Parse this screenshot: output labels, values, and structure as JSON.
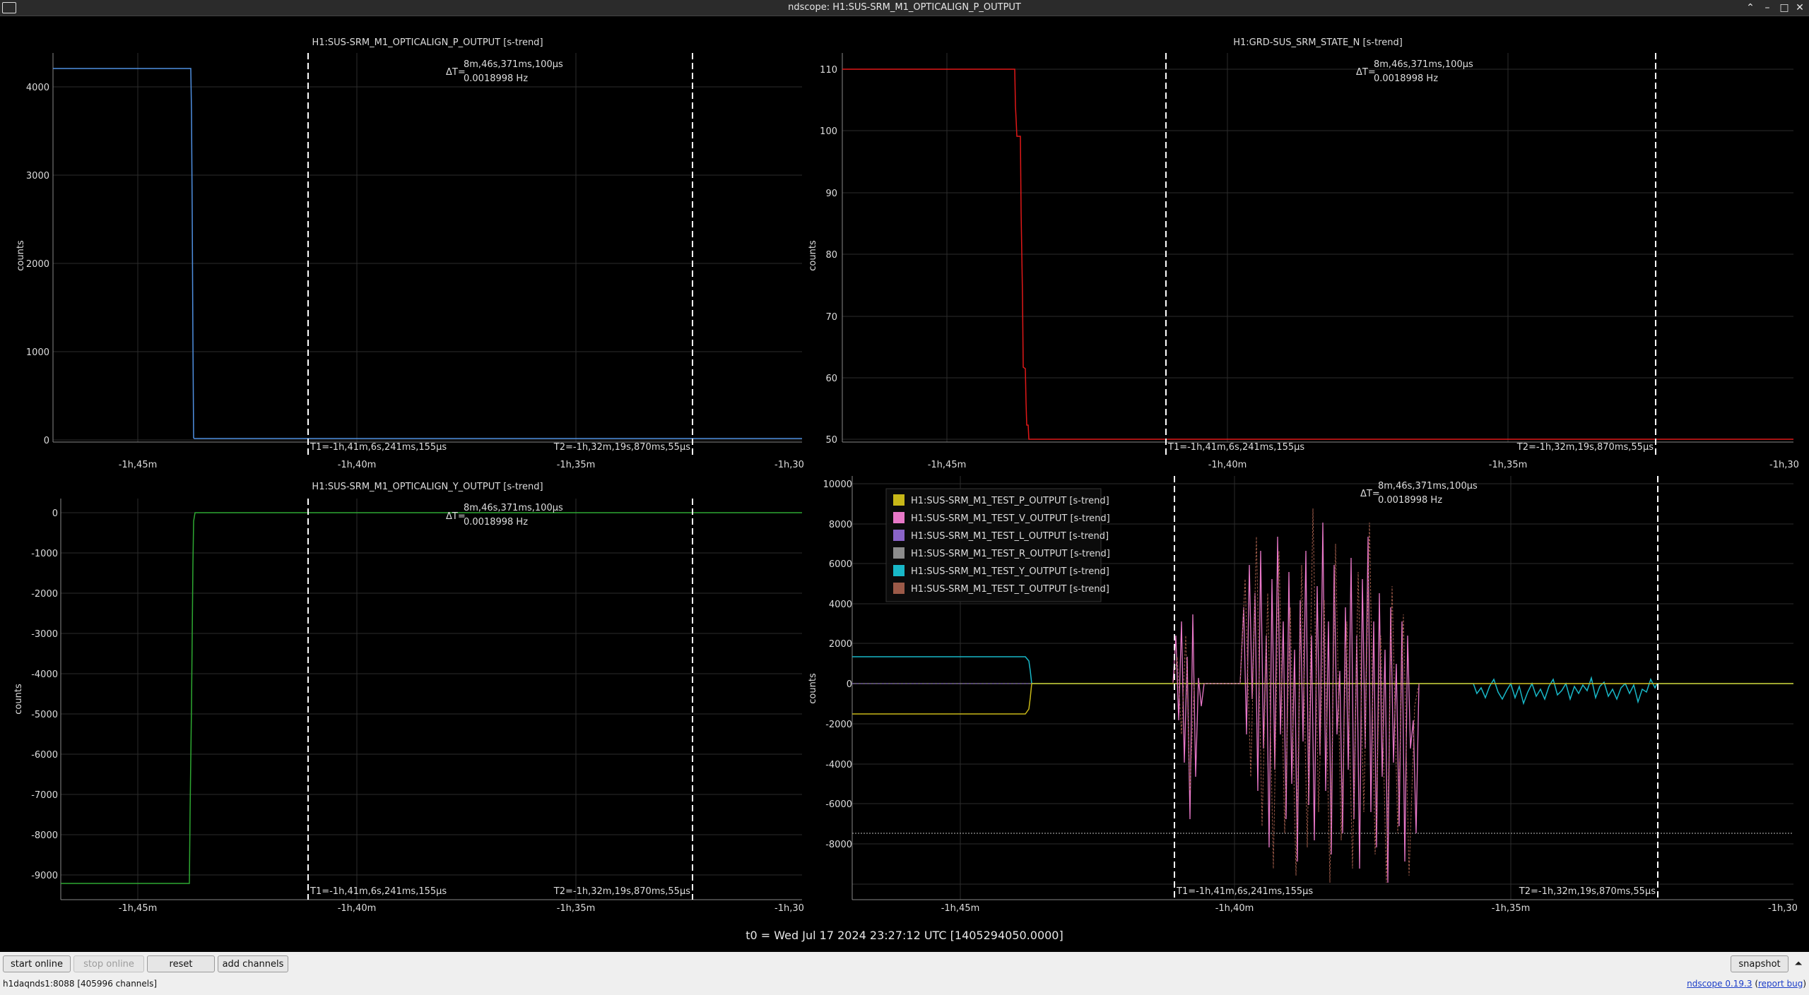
{
  "window": {
    "title": "ndscope: H1:SUS-SRM_M1_OPTICALIGN_P_OUTPUT",
    "min_glyph": "–",
    "max_glyph": "□",
    "close_glyph": "✕",
    "shade_glyph": "⌃"
  },
  "t0_label": "t0 = Wed Jul 17 2024 23:27:12 UTC [1405294050.0000]",
  "cursors": {
    "delta_prefix": "ΔT=",
    "delta_time": "8m,46s,371ms,100µs",
    "delta_freq": "0.0018998 Hz",
    "t1": "T1=-1h,41m,6s,241ms,155µs",
    "t2": "T2=-1h,32m,19s,870ms,55µs"
  },
  "plots": [
    {
      "title": "H1:SUS-SRM_M1_OPTICALIGN_P_OUTPUT [s-trend]",
      "ylabel": "counts",
      "yticks": [
        "4000",
        "3000",
        "2000",
        "1000",
        "0"
      ],
      "xticks": [
        "-1h,45m",
        "-1h,40m",
        "-1h,35m",
        "-1h,30"
      ],
      "line_color": "#4f8fe0"
    },
    {
      "title": "H1:GRD-SUS_SRM_STATE_N [s-trend]",
      "ylabel": "counts",
      "yticks": [
        "110",
        "100",
        "90",
        "80",
        "70",
        "60",
        "50"
      ],
      "xticks": [
        "-1h,45m",
        "-1h,40m",
        "-1h,35m",
        "-1h,30"
      ],
      "line_color": "#e01818"
    },
    {
      "title": "H1:SUS-SRM_M1_OPTICALIGN_Y_OUTPUT [s-trend]",
      "ylabel": "counts",
      "yticks": [
        "0",
        "-1000",
        "-2000",
        "-3000",
        "-4000",
        "-5000",
        "-6000",
        "-7000",
        "-8000",
        "-9000"
      ],
      "xticks": [
        "-1h,45m",
        "-1h,40m",
        "-1h,35m",
        "-1h,30"
      ],
      "line_color": "#2ea832"
    },
    {
      "title": "",
      "ylabel": "counts",
      "yticks": [
        "10000",
        "8000",
        "6000",
        "4000",
        "2000",
        "0",
        "-2000",
        "-4000",
        "-6000",
        "-8000"
      ],
      "xticks": [
        "-1h,45m",
        "-1h,40m",
        "-1h,35m",
        "-1h,30"
      ],
      "legend": [
        {
          "name": "H1:SUS-SRM_M1_TEST_P_OUTPUT [s-trend]",
          "color": "#c8b818"
        },
        {
          "name": "H1:SUS-SRM_M1_TEST_V_OUTPUT [s-trend]",
          "color": "#e878c8"
        },
        {
          "name": "H1:SUS-SRM_M1_TEST_L_OUTPUT [s-trend]",
          "color": "#8a64c8"
        },
        {
          "name": "H1:SUS-SRM_M1_TEST_R_OUTPUT [s-trend]",
          "color": "#8c8c8c"
        },
        {
          "name": "H1:SUS-SRM_M1_TEST_Y_OUTPUT [s-trend]",
          "color": "#18b8c8"
        },
        {
          "name": "H1:SUS-SRM_M1_TEST_T_OUTPUT [s-trend]",
          "color": "#9c5a48"
        }
      ]
    }
  ],
  "buttons": {
    "start_online": "start online",
    "stop_online": "stop online",
    "reset": "reset",
    "add_channels": "add channels",
    "snapshot": "snapshot",
    "expand_glyph": "⏶"
  },
  "status": "h1daqnds1:8088  [405996 channels]",
  "version": {
    "app": "ndscope 0.19.3",
    "report_bug": "report bug"
  }
}
